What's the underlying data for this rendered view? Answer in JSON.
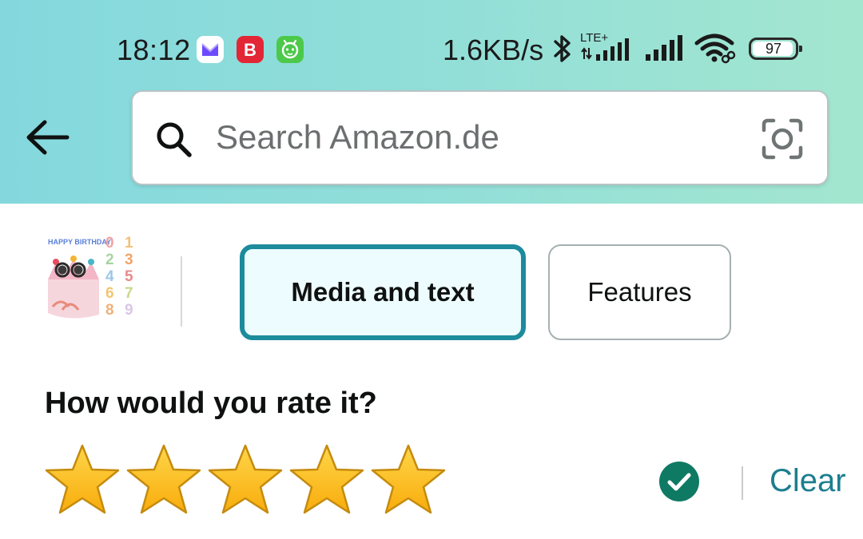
{
  "status_bar": {
    "time": "18:12",
    "network_speed": "1.6KB/s",
    "network_type": "LTE+",
    "battery_level": "97",
    "battery_fraction": 0.97,
    "notification_icons": [
      "proton-mail-icon",
      "b-app-icon",
      "green-robot-app-icon"
    ]
  },
  "header": {
    "back_icon": "arrow-left-icon",
    "search": {
      "placeholder": "Search Amazon.de",
      "value": "",
      "search_icon": "search-icon",
      "camera_icon": "camera-lens-icon"
    }
  },
  "product": {
    "thumbnail_caption": "HAPPY BIRTHDAY",
    "thumbnail_numbers": [
      "0",
      "1",
      "2",
      "3",
      "4",
      "5",
      "6",
      "7",
      "8",
      "9"
    ]
  },
  "tabs": [
    {
      "label": "Media and text",
      "selected": true
    },
    {
      "label": "Features",
      "selected": false
    }
  ],
  "rating": {
    "heading": "How would you rate it?",
    "value": 5,
    "max": 5,
    "clear_label": "Clear"
  },
  "colors": {
    "header_gradient_start": "#84d8dd",
    "header_gradient_end": "#a3e6cf",
    "tab_selected_border": "#1c8b9c",
    "tab_selected_bg": "#edfdff",
    "star_fill": "#ffc21a",
    "star_stroke": "#c58b0e",
    "check_bg": "#0f7a63",
    "clear_link": "#1c7e8e"
  }
}
